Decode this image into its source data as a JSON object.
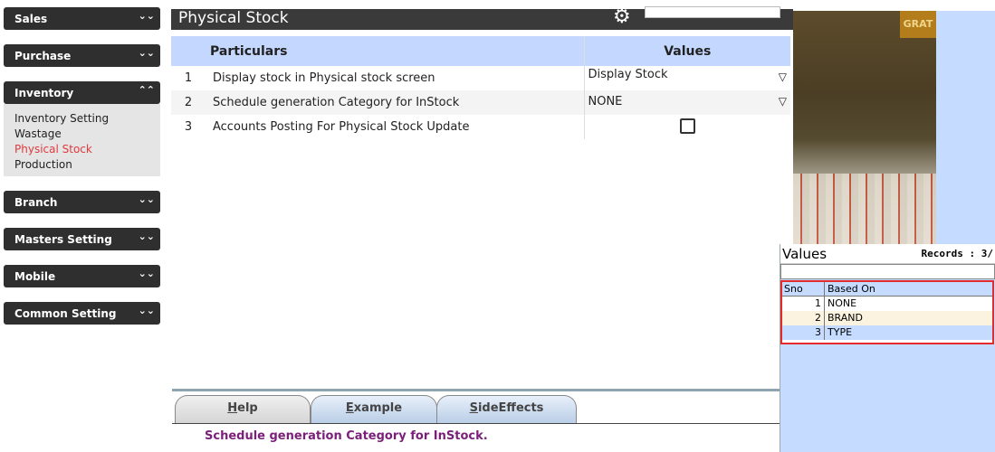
{
  "sidebar": {
    "items": [
      {
        "label": "Sales",
        "chevron": "chevron-double-down"
      },
      {
        "label": "Purchase",
        "chevron": "chevron-double-down"
      },
      {
        "label": "Inventory",
        "chevron": "chevron-double-up"
      },
      {
        "label": "Branch",
        "chevron": "chevron-double-down"
      },
      {
        "label": "Masters Setting",
        "chevron": "chevron-double-down"
      },
      {
        "label": "Mobile",
        "chevron": "chevron-double-down"
      },
      {
        "label": "Common Setting",
        "chevron": "chevron-double-down"
      }
    ],
    "inventory_sub": [
      "Inventory Setting",
      "Wastage",
      "Physical Stock",
      "Production"
    ],
    "active_sub": "Physical Stock"
  },
  "main": {
    "title": "Physical Stock",
    "headers": {
      "particulars": "Particulars",
      "values": "Values"
    },
    "rows": [
      {
        "no": "1",
        "particular": "Display stock in Physical stock screen",
        "value": "Display Stock",
        "control": "dropdown"
      },
      {
        "no": "2",
        "particular": "Schedule generation Category for InStock",
        "value": "NONE",
        "control": "dropdown"
      },
      {
        "no": "3",
        "particular": "Accounts Posting For Physical Stock Update",
        "value": "",
        "control": "checkbox"
      }
    ]
  },
  "photo": {
    "sign_text": "GRAT"
  },
  "popup": {
    "title": "Values",
    "records": "Records : 3/",
    "columns": {
      "sno": "Sno",
      "based_on": "Based On"
    },
    "items": [
      {
        "sno": "1",
        "based_on": "NONE"
      },
      {
        "sno": "2",
        "based_on": "BRAND"
      },
      {
        "sno": "3",
        "based_on": "TYPE"
      }
    ]
  },
  "tabs": {
    "help": {
      "first": "H",
      "rest": "elp"
    },
    "example": {
      "first": "E",
      "rest": "xample"
    },
    "side": {
      "first": "S",
      "rest": "ideEffects"
    }
  },
  "help_text": "Schedule generation Category for InStock.",
  "colors": {
    "active": "#e0393e",
    "header_blue": "#c4d8ff",
    "help_text": "#7a1f7a",
    "selection_border": "#e32b2b"
  }
}
